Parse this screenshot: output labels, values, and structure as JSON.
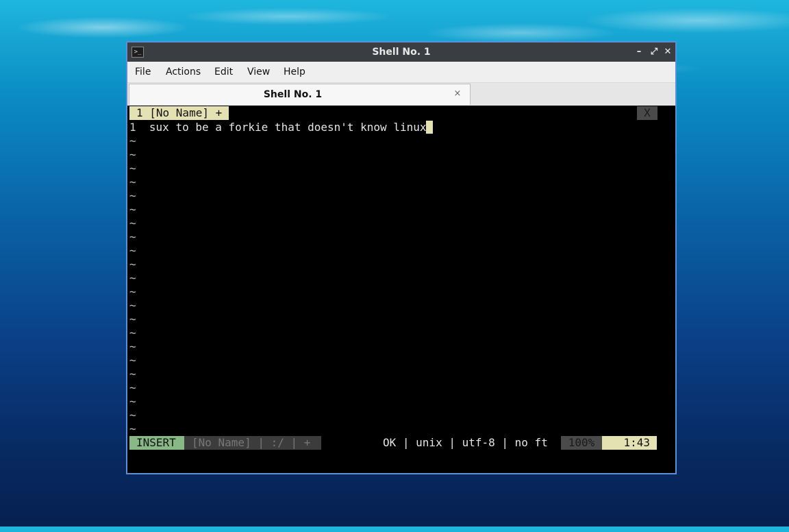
{
  "window": {
    "title": "Shell No. 1",
    "controls": {
      "minimize": "–",
      "restore": "⤢",
      "close": "✕"
    },
    "app_icon": ">_"
  },
  "menu": [
    "File",
    "Actions",
    "Edit",
    "View",
    "Help"
  ],
  "tabs": [
    {
      "label": "Shell No. 1",
      "close": "×"
    }
  ],
  "vim": {
    "tabline": {
      "buffer": "1 [No Name] +",
      "close": "X"
    },
    "line_number": "1",
    "line_text": "  sux to be a forkie that doesn't know linux",
    "tilde": "~",
    "tilde_count": 22,
    "statusline": {
      "mode": "INSERT",
      "file_info": "[No Name] | :/ | +",
      "enc_info": "OK | unix | utf-8 | no ft",
      "percent": "100%",
      "position": "1:43"
    }
  },
  "colors": {
    "accent_border": "#5b8fd8",
    "tabline_bg": "#e4e1b2",
    "insert_mode_bg": "#88b886"
  }
}
